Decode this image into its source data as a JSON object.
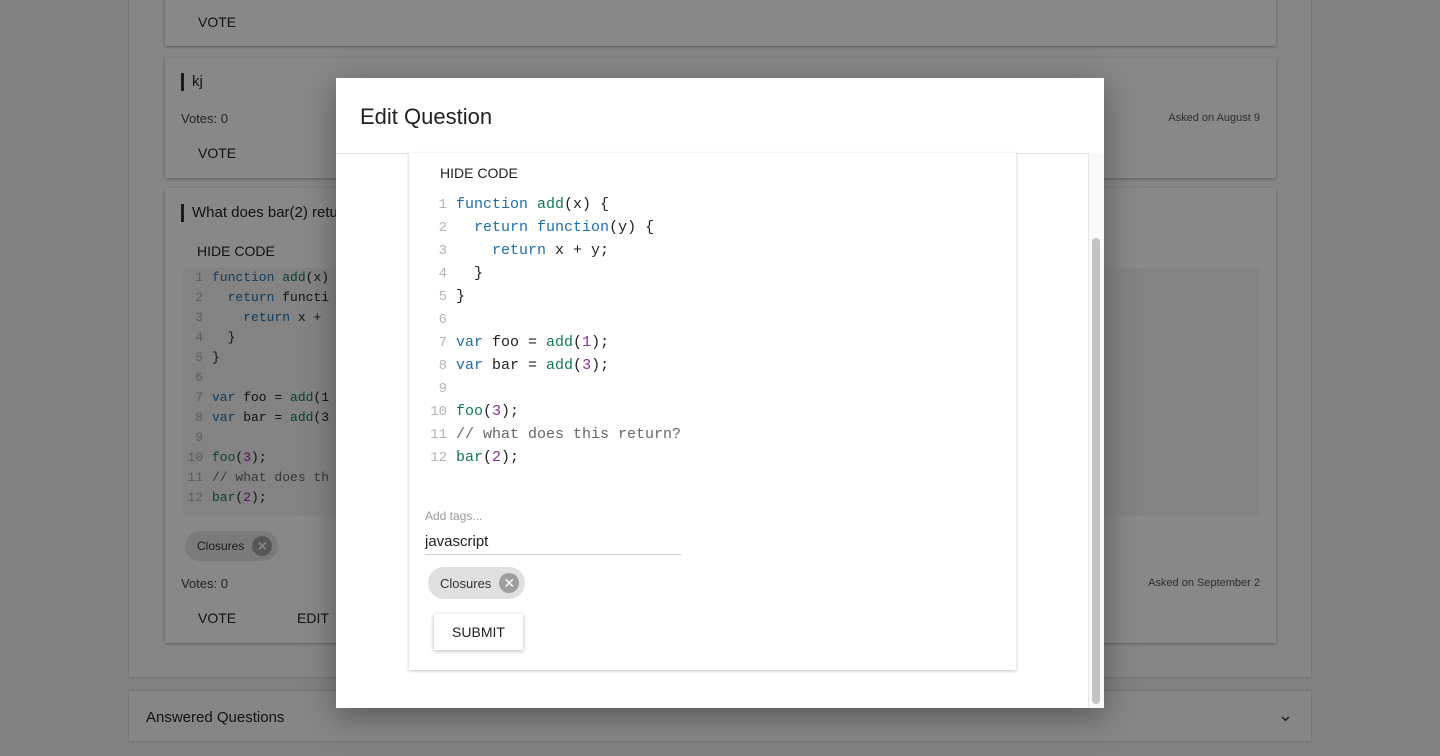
{
  "background": {
    "card1": {
      "vote_label": "VOTE"
    },
    "card2": {
      "title": "kj",
      "votes": "Votes: 0",
      "asked": "Asked on August 9",
      "vote_label": "VOTE"
    },
    "card3": {
      "title": "What does bar(2) retu",
      "hide_code_label": "HIDE CODE",
      "code_lines": [
        {
          "n": "1",
          "t": "function add(x)"
        },
        {
          "n": "2",
          "t": "  return functi"
        },
        {
          "n": "3",
          "t": "    return x + "
        },
        {
          "n": "4",
          "t": "  }"
        },
        {
          "n": "5",
          "t": "}"
        },
        {
          "n": "6",
          "t": ""
        },
        {
          "n": "7",
          "t": "var foo = add(1"
        },
        {
          "n": "8",
          "t": "var bar = add(3"
        },
        {
          "n": "9",
          "t": ""
        },
        {
          "n": "10",
          "t": "foo(3);"
        },
        {
          "n": "11",
          "t": "// what does th"
        },
        {
          "n": "12",
          "t": "bar(2);"
        }
      ],
      "tag_chip": "Closures",
      "votes": "Votes: 0",
      "asked": "Asked on September 2",
      "vote_label": "VOTE",
      "edit_label": "EDIT"
    },
    "answered_label": "Answered Questions",
    "chevron_icon": "chevron-down-icon"
  },
  "modal": {
    "title": "Edit Question",
    "hide_code_label": "HIDE CODE",
    "code_lines": [
      {
        "n": "1",
        "t": "function add(x) {"
      },
      {
        "n": "2",
        "t": "  return function(y) {"
      },
      {
        "n": "3",
        "t": "    return x + y;"
      },
      {
        "n": "4",
        "t": "  }"
      },
      {
        "n": "5",
        "t": "}"
      },
      {
        "n": "6",
        "t": ""
      },
      {
        "n": "7",
        "t": "var foo = add(1);"
      },
      {
        "n": "8",
        "t": "var bar = add(3);"
      },
      {
        "n": "9",
        "t": ""
      },
      {
        "n": "10",
        "t": "foo(3);"
      },
      {
        "n": "11",
        "t": "// what does this return?"
      },
      {
        "n": "12",
        "t": "bar(2);"
      }
    ],
    "tags_placeholder": "Add tags...",
    "tags_value": "javascript",
    "tag_chip": "Closures",
    "submit_label": "SUBMIT",
    "chip_close_icon": "close-circle-icon"
  }
}
